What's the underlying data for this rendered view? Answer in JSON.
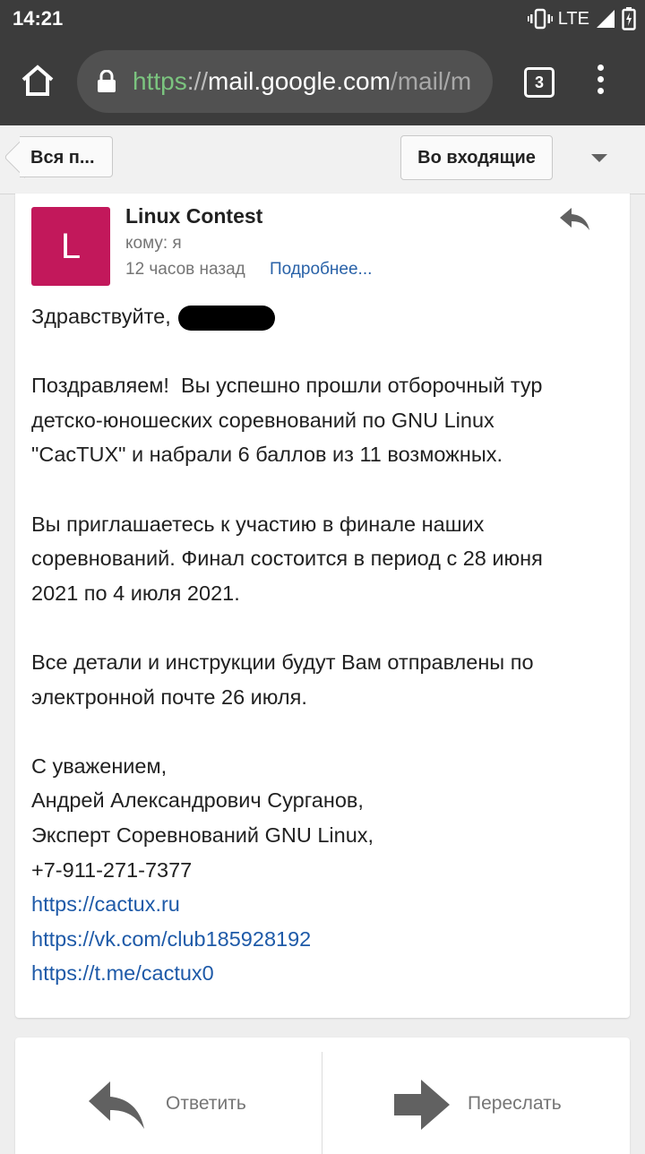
{
  "status_bar": {
    "time": "14:21",
    "network": "LTE",
    "icons": [
      "vibrate-icon",
      "signal-icon",
      "battery-icon"
    ]
  },
  "browser": {
    "url_scheme": "https",
    "url_separator": "://",
    "url_host": "mail.google.com",
    "url_path": "/mail/m",
    "tab_count": "3",
    "icons": [
      "home-icon",
      "lock-icon",
      "tabs-icon",
      "overflow-menu-icon"
    ]
  },
  "gmail_nav": {
    "back_label": "Вся п...",
    "inbox_label": "Во входящие"
  },
  "message": {
    "avatar_letter": "L",
    "avatar_color": "#c2185b",
    "sender": "Linux Contest",
    "recipient": "кому: я",
    "time": "12 часов назад",
    "details": "Подробнее...",
    "greeting": "Здравствуйте,",
    "paragraph1_line1": "Поздравляем!  Вы успешно прошли отборочный тур",
    "paragraph1_line2": "детско-юношеских соревнований по GNU Linux",
    "paragraph1_line3": "\"CacTUX\" и набрали 6 баллов из 11 возможных.",
    "paragraph2_line1": "Вы приглашаетесь к участию в финале наших",
    "paragraph2_line2": "соревнований. Финал состоится в период с 28 июня",
    "paragraph2_line3": "2021 по 4 июля 2021.",
    "paragraph3_line1": "Все детали и инструкции будут Вам отправлены по",
    "paragraph3_line2": "электронной почте 26 июля.",
    "signature": {
      "closing": "С уважением,",
      "name": "Андрей Александрович Сурганов,",
      "role": "Эксперт Соревнований GNU Linux,",
      "phone": "+7-911-271-7377",
      "links": [
        "https://cactux.ru",
        "https://vk.com/club185928192",
        "https://t.me/cactux0"
      ]
    }
  },
  "actions": {
    "reply_label": "Ответить",
    "forward_label": "Переслать"
  },
  "colors": {
    "toolbar": "#3c3c3c",
    "link": "#1e5aa8",
    "url_scheme": "#7bc47f"
  }
}
